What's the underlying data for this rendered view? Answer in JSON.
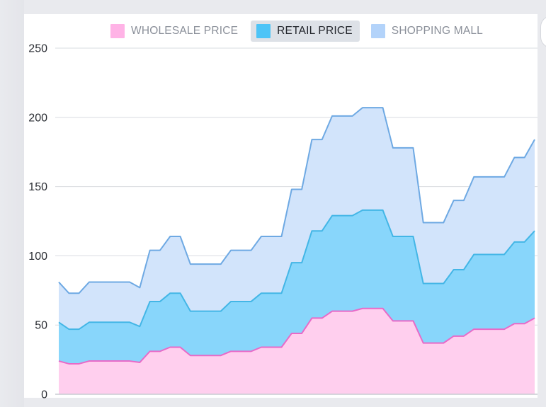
{
  "chart_data": {
    "type": "area",
    "stacked": true,
    "step": true,
    "ylim": [
      0,
      250
    ],
    "yticks": [
      "0",
      "50",
      "100",
      "150",
      "200",
      "250"
    ],
    "grid": true,
    "legend_position": "top-center",
    "series": [
      {
        "name": "WHOLESALE PRICE",
        "legend_active": false,
        "swatch": "#ffb3e6",
        "fill": "#ffcfee",
        "stroke": "#e86ac8",
        "values": [
          24,
          22,
          22,
          24,
          24,
          24,
          24,
          24,
          23,
          31,
          31,
          34,
          34,
          28,
          28,
          28,
          28,
          31,
          31,
          31,
          34,
          34,
          34,
          44,
          44,
          55,
          55,
          60,
          60,
          60,
          62,
          62,
          62,
          53,
          53,
          53,
          37,
          37,
          37,
          42,
          42,
          47,
          47,
          47,
          47,
          51,
          51,
          55
        ]
      },
      {
        "name": "RETAIL PRICE",
        "legend_active": true,
        "swatch": "#4dc4f7",
        "fill": "#88d6fb",
        "stroke": "#43b6e6",
        "values": [
          52,
          47,
          47,
          52,
          52,
          52,
          52,
          52,
          49,
          67,
          67,
          73,
          73,
          60,
          60,
          60,
          60,
          67,
          67,
          67,
          73,
          73,
          73,
          95,
          95,
          118,
          118,
          129,
          129,
          129,
          133,
          133,
          133,
          114,
          114,
          114,
          80,
          80,
          80,
          90,
          90,
          101,
          101,
          101,
          101,
          110,
          110,
          118
        ]
      },
      {
        "name": "SHOPPING MALL",
        "legend_active": false,
        "swatch": "#b3d3fa",
        "fill": "#d2e4fb",
        "stroke": "#6ea9e3",
        "values": [
          81,
          73,
          73,
          81,
          81,
          81,
          81,
          81,
          77,
          104,
          104,
          114,
          114,
          94,
          94,
          94,
          94,
          104,
          104,
          104,
          114,
          114,
          114,
          148,
          148,
          184,
          184,
          201,
          201,
          201,
          207,
          207,
          207,
          178,
          178,
          178,
          124,
          124,
          124,
          140,
          140,
          157,
          157,
          157,
          157,
          171,
          171,
          184
        ]
      }
    ]
  }
}
